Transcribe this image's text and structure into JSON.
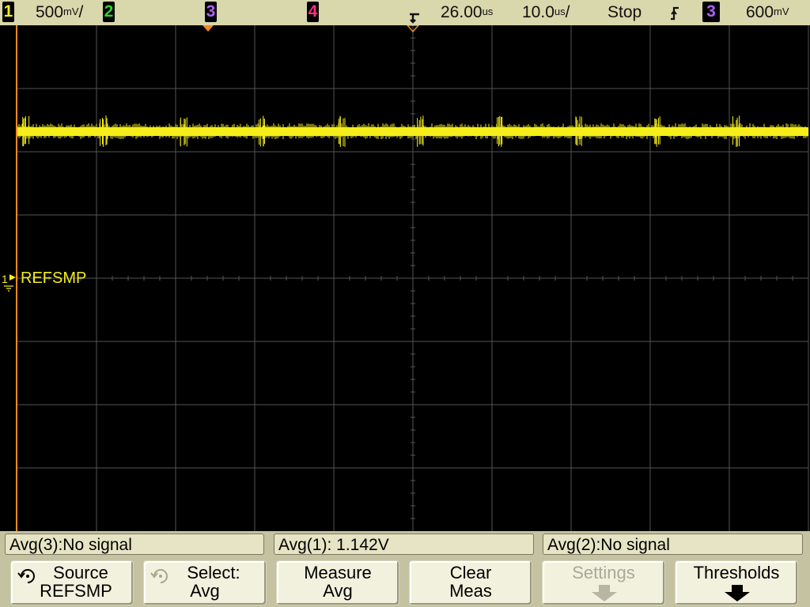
{
  "status": {
    "ch1": {
      "num": "1",
      "scale": "500",
      "unit": "mV",
      "suffix": "/",
      "color": "#f5ee1a"
    },
    "ch2": {
      "num": "2",
      "color": "#30d030"
    },
    "ch3": {
      "num": "3",
      "color": "#b060ff"
    },
    "ch4": {
      "num": "4",
      "color": "#ff3080"
    },
    "delay": {
      "value": "26.00",
      "unit": "us"
    },
    "timebase": {
      "value": "10.0",
      "unit": "us",
      "suffix": "/"
    },
    "run_state": "Stop",
    "trigger": {
      "source": "3",
      "level": "600",
      "unit": "mV"
    }
  },
  "screen": {
    "channel1_label": "REFSMP",
    "channel1_marker": "1",
    "trace_color": "#f5ee1a"
  },
  "measurements": [
    {
      "label": "Avg(3):No signal"
    },
    {
      "label": "Avg(1): 1.142V"
    },
    {
      "label": "Avg(2):No signal"
    }
  ],
  "softkeys": [
    {
      "line1": "Source",
      "line2": "REFSMP",
      "icon": "rotary-knob-icon"
    },
    {
      "line1": "Select:",
      "line2": "Avg",
      "icon": "rotary-knob-icon"
    },
    {
      "line1": "Measure",
      "line2": "Avg"
    },
    {
      "line1": "Clear",
      "line2": "Meas"
    },
    {
      "line1": "Settings",
      "icon": "down-arrow-icon"
    },
    {
      "line1": "Thresholds",
      "icon": "down-arrow-icon"
    }
  ]
}
